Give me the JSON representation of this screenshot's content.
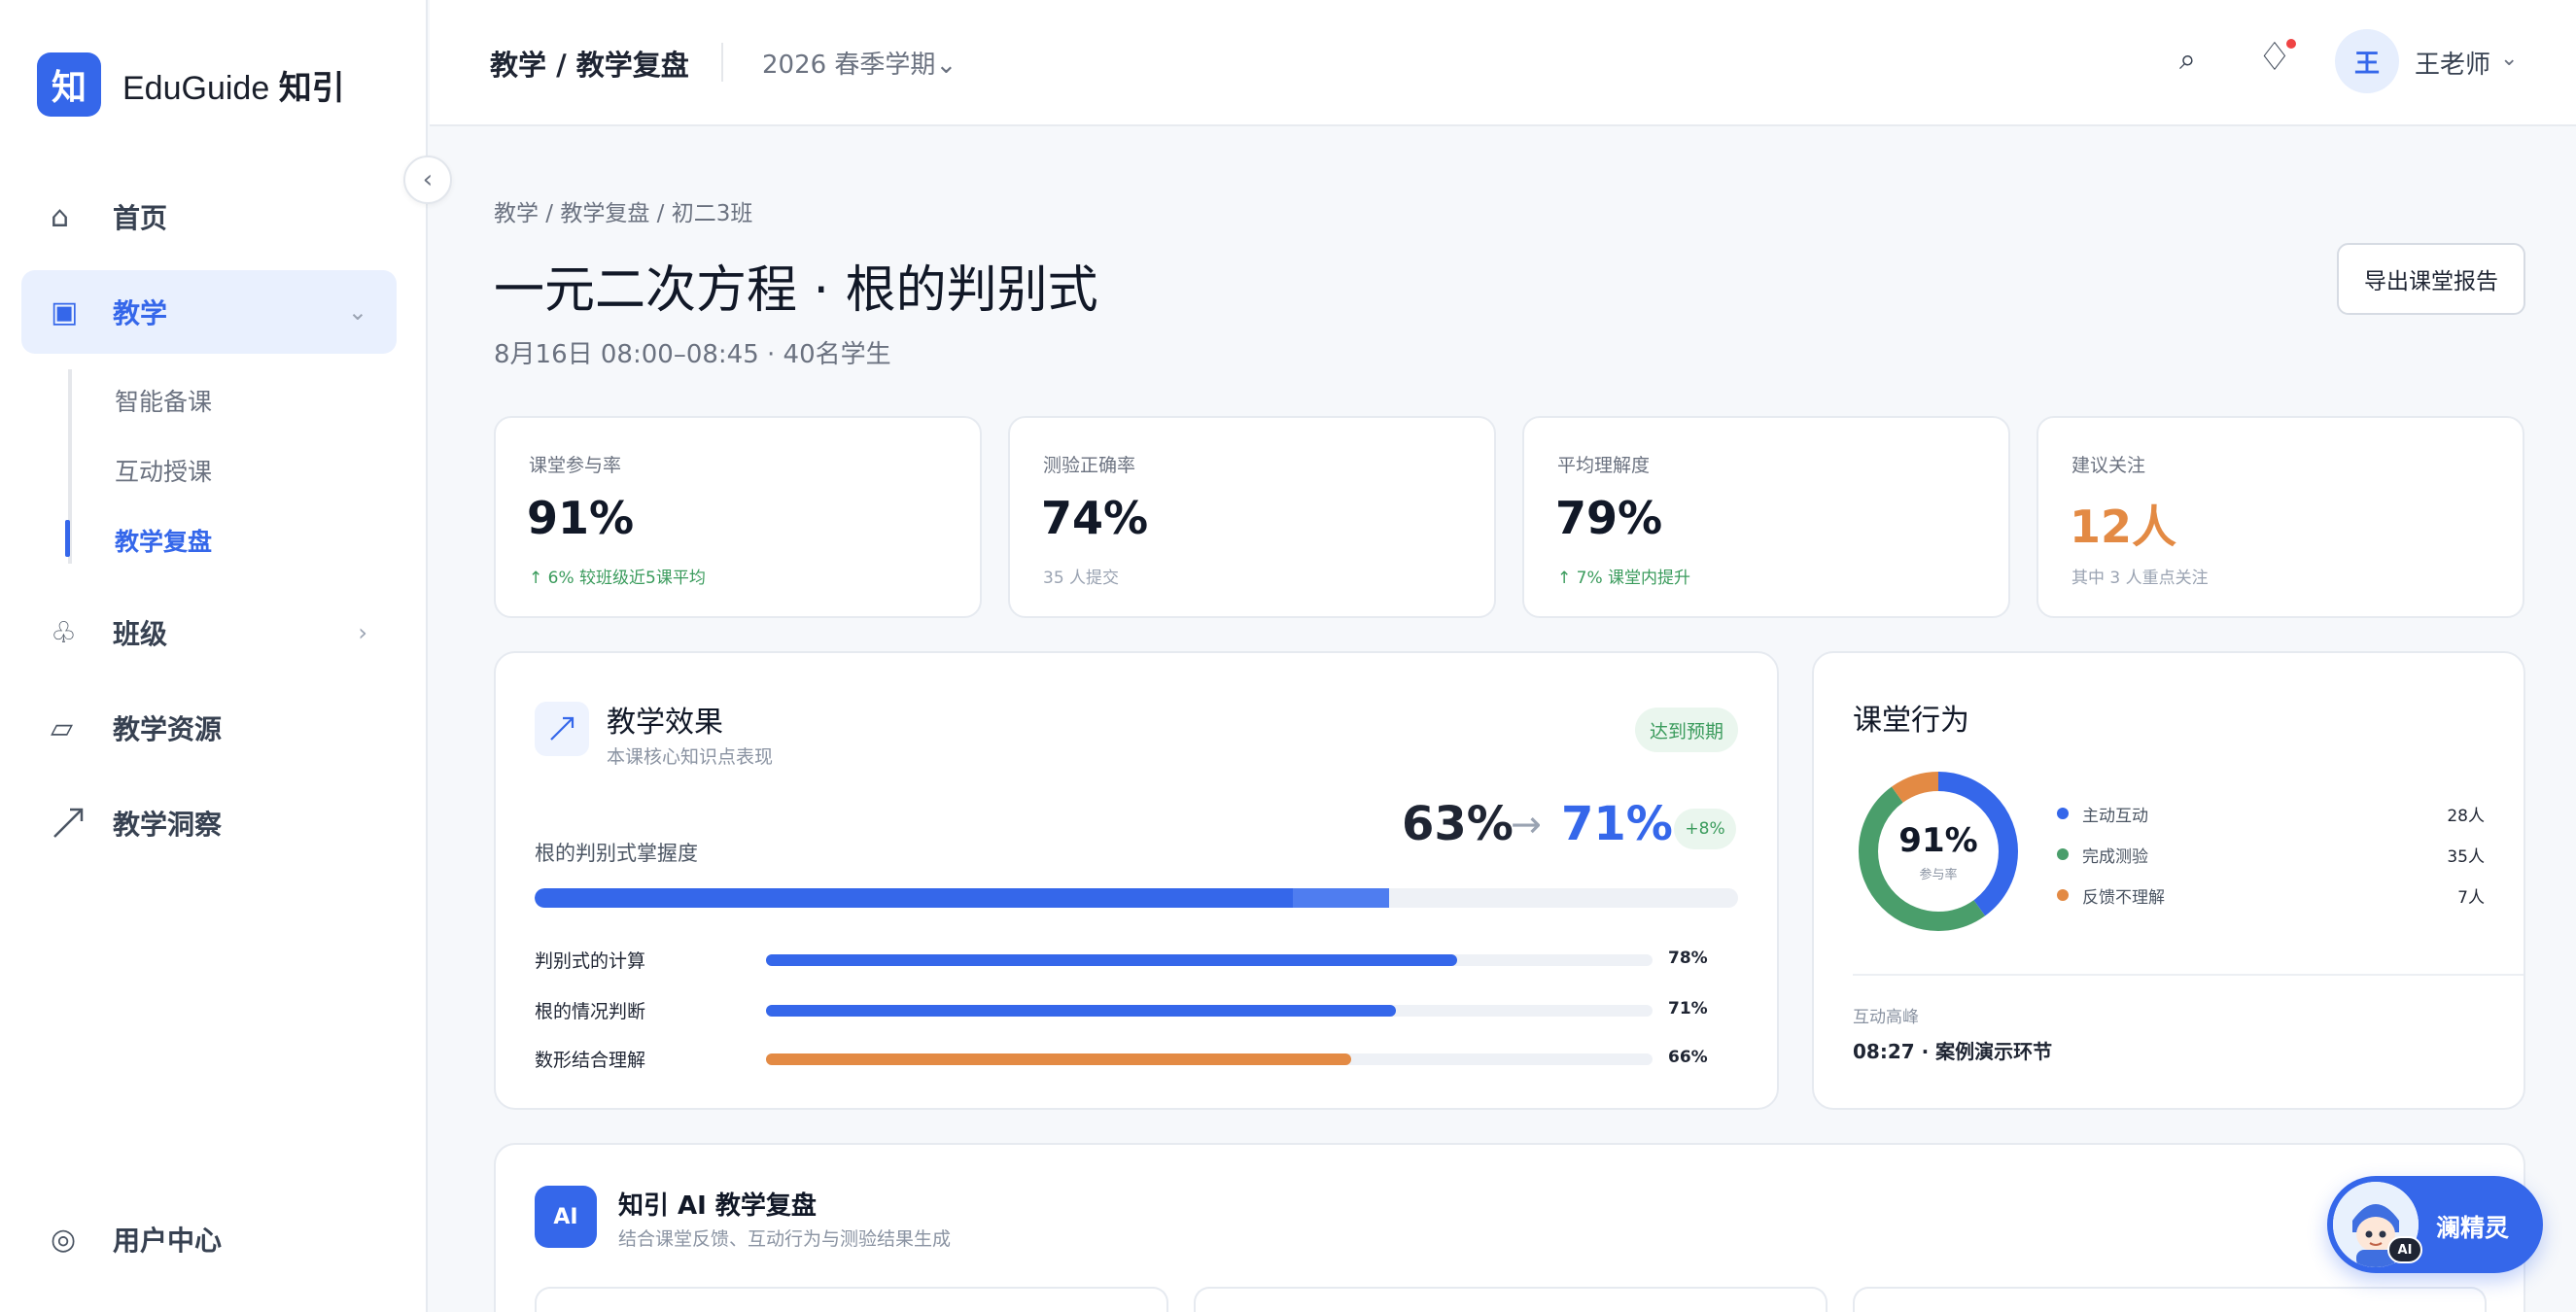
{
  "app": {
    "logo_char": "知",
    "name_en": "EduGuide",
    "name_cn": "知引"
  },
  "sidebar": {
    "collapse_icon": "‹",
    "items": [
      {
        "label": "首页",
        "icon": "home-icon"
      },
      {
        "label": "教学",
        "icon": "teaching-icon"
      },
      {
        "label": "班级",
        "icon": "class-icon"
      },
      {
        "label": "教学资源",
        "icon": "resource-icon"
      },
      {
        "label": "教学洞察",
        "icon": "insight-icon"
      }
    ],
    "sub_items": [
      "智能备课",
      "互动授课",
      "教学复盘"
    ],
    "bottom": {
      "label": "用户中心",
      "icon": "user-center-icon"
    }
  },
  "topbar": {
    "crumb": "教学 / 教学复盘",
    "semester": "2026 春季学期",
    "user_avatar": "王",
    "user_name": "王老师"
  },
  "page": {
    "breadcrumb": "教学 / 教学复盘 / 初二3班",
    "title": "一元二次方程 · 根的判别式",
    "subtitle": "8月16日 08:00–08:45 · 40名学生",
    "export_label": "导出课堂报告"
  },
  "stats": [
    {
      "label": "课堂参与率",
      "value": "91%",
      "note": "↑ 6% 较班级近5课平均"
    },
    {
      "label": "测验正确率",
      "value": "74%",
      "note": "35 人提交"
    },
    {
      "label": "平均理解度",
      "value": "79%",
      "note": "↑ 7% 课堂内提升"
    },
    {
      "label": "建议关注",
      "value": "12人",
      "note": "其中 3 人重点关注"
    }
  ],
  "effect": {
    "title": "教学效果",
    "subtitle": "本课核心知识点表现",
    "badge": "达到预期",
    "mastery_label": "根的判别式掌握度",
    "before": "63%",
    "arrow": "→",
    "after": "71%",
    "delta": "+8%",
    "before_value": 63,
    "after_value": 71,
    "rows": [
      {
        "label": "判别式的计算",
        "value": 78,
        "display": "78%",
        "color": "#3567ea"
      },
      {
        "label": "根的情况判断",
        "value": 71,
        "display": "71%",
        "color": "#3567ea"
      },
      {
        "label": "数形结合理解",
        "value": 66,
        "display": "66%",
        "color": "#e38a44"
      }
    ]
  },
  "behavior": {
    "title": "课堂行为",
    "donut_value": "91%",
    "donut_label": "参与率",
    "legend": [
      {
        "label": "主动互动",
        "value": "28人",
        "count": 28,
        "color": "#3567ea"
      },
      {
        "label": "完成测验",
        "value": "35人",
        "count": 35,
        "color": "#4a9e6b"
      },
      {
        "label": "反馈不理解",
        "value": "7人",
        "count": 7,
        "color": "#e38a44"
      }
    ],
    "peak_label": "互动高峰",
    "peak_value": "08:27 · 案例演示环节"
  },
  "ai": {
    "badge": "AI",
    "title": "知引 AI 教学复盘",
    "subtitle": "结合课堂反馈、互动行为与测验结果生成"
  },
  "assistant": {
    "name": "澜精灵",
    "tag": "AI"
  }
}
